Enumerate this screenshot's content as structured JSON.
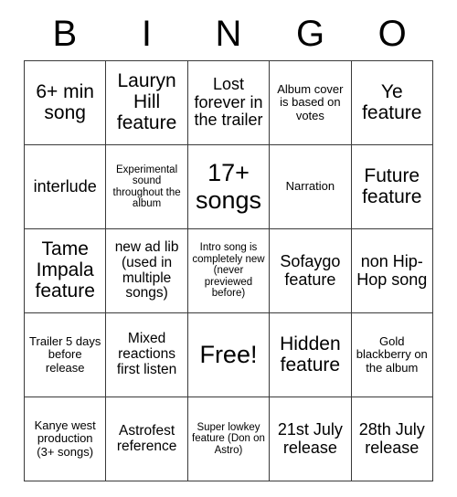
{
  "card": {
    "title_letters": [
      "B",
      "I",
      "N",
      "G",
      "O"
    ],
    "border_color": "#3a3a3a",
    "background_color": "#ffffff",
    "text_color": "#000000",
    "rows": [
      [
        {
          "text": "6+ min song",
          "size": "xl"
        },
        {
          "text": "Lauryn Hill feature",
          "size": "xl"
        },
        {
          "text": "Lost forever in the trailer",
          "size": "l"
        },
        {
          "text": "Album cover is based on votes",
          "size": "s"
        },
        {
          "text": "Ye feature",
          "size": "xl"
        }
      ],
      [
        {
          "text": "interlude",
          "size": "l"
        },
        {
          "text": "Experimental sound throughout the album",
          "size": "xs"
        },
        {
          "text": "17+ songs",
          "size": "xxl"
        },
        {
          "text": "Narration",
          "size": "s"
        },
        {
          "text": "Future feature",
          "size": "xl"
        }
      ],
      [
        {
          "text": "Tame Impala feature",
          "size": "xl"
        },
        {
          "text": "new ad lib (used in multiple songs)",
          "size": "m"
        },
        {
          "text": "Intro song is completely new (never previewed before)",
          "size": "xs"
        },
        {
          "text": "Sofaygo feature",
          "size": "l"
        },
        {
          "text": "non Hip-Hop song",
          "size": "l"
        }
      ],
      [
        {
          "text": "Trailer 5 days before release",
          "size": "s"
        },
        {
          "text": "Mixed reactions first listen",
          "size": "m"
        },
        {
          "text": "Free!",
          "size": "xxl"
        },
        {
          "text": "Hidden feature",
          "size": "xl"
        },
        {
          "text": "Gold blackberry on the album",
          "size": "s"
        }
      ],
      [
        {
          "text": "Kanye west production (3+ songs)",
          "size": "s"
        },
        {
          "text": "Astrofest reference",
          "size": "m"
        },
        {
          "text": "Super lowkey feature (Don on Astro)",
          "size": "xs"
        },
        {
          "text": "21st July release",
          "size": "l"
        },
        {
          "text": "28th July release",
          "size": "l"
        }
      ]
    ]
  }
}
